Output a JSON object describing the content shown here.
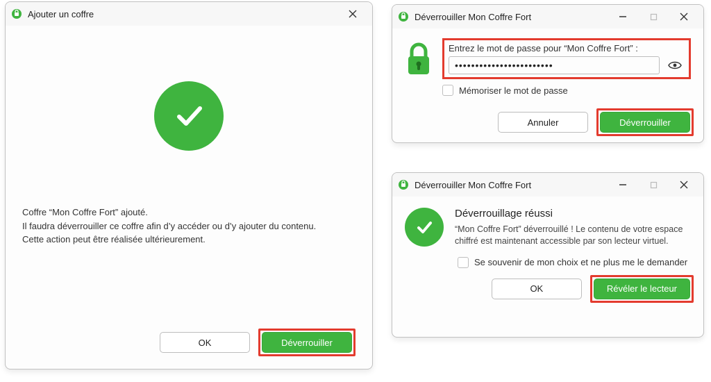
{
  "colors": {
    "accent_green": "#3fb43f",
    "highlight_red": "#e33b2e"
  },
  "dialog1": {
    "title": "Ajouter un coffre",
    "msg_line1": "Coffre “Mon Coffre Fort” ajouté.",
    "msg_line2": "Il faudra déverrouiller ce coffre afin d’y accéder ou d’y ajouter du contenu.",
    "msg_line3": "Cette action peut être réalisée ultérieurement.",
    "ok_label": "OK",
    "unlock_label": "Déverrouiller"
  },
  "dialog2": {
    "title": "Déverrouiller Mon Coffre Fort",
    "pw_label": "Entrez le mot de passe pour “Mon Coffre Fort” :",
    "pw_value": "••••••••••••••••••••••••",
    "remember_label": "Mémoriser le mot de passe",
    "cancel_label": "Annuler",
    "unlock_label": "Déverrouiller"
  },
  "dialog3": {
    "title": "Déverrouiller Mon Coffre Fort",
    "heading": "Déverrouillage réussi",
    "body": "“Mon Coffre Fort” déverrouillé ! Le contenu de votre espace chiffré est maintenant accessible par son lecteur virtuel.",
    "remember_label": "Se souvenir de mon choix et ne plus me le demander",
    "ok_label": "OK",
    "reveal_label": "Révéler le lecteur"
  }
}
